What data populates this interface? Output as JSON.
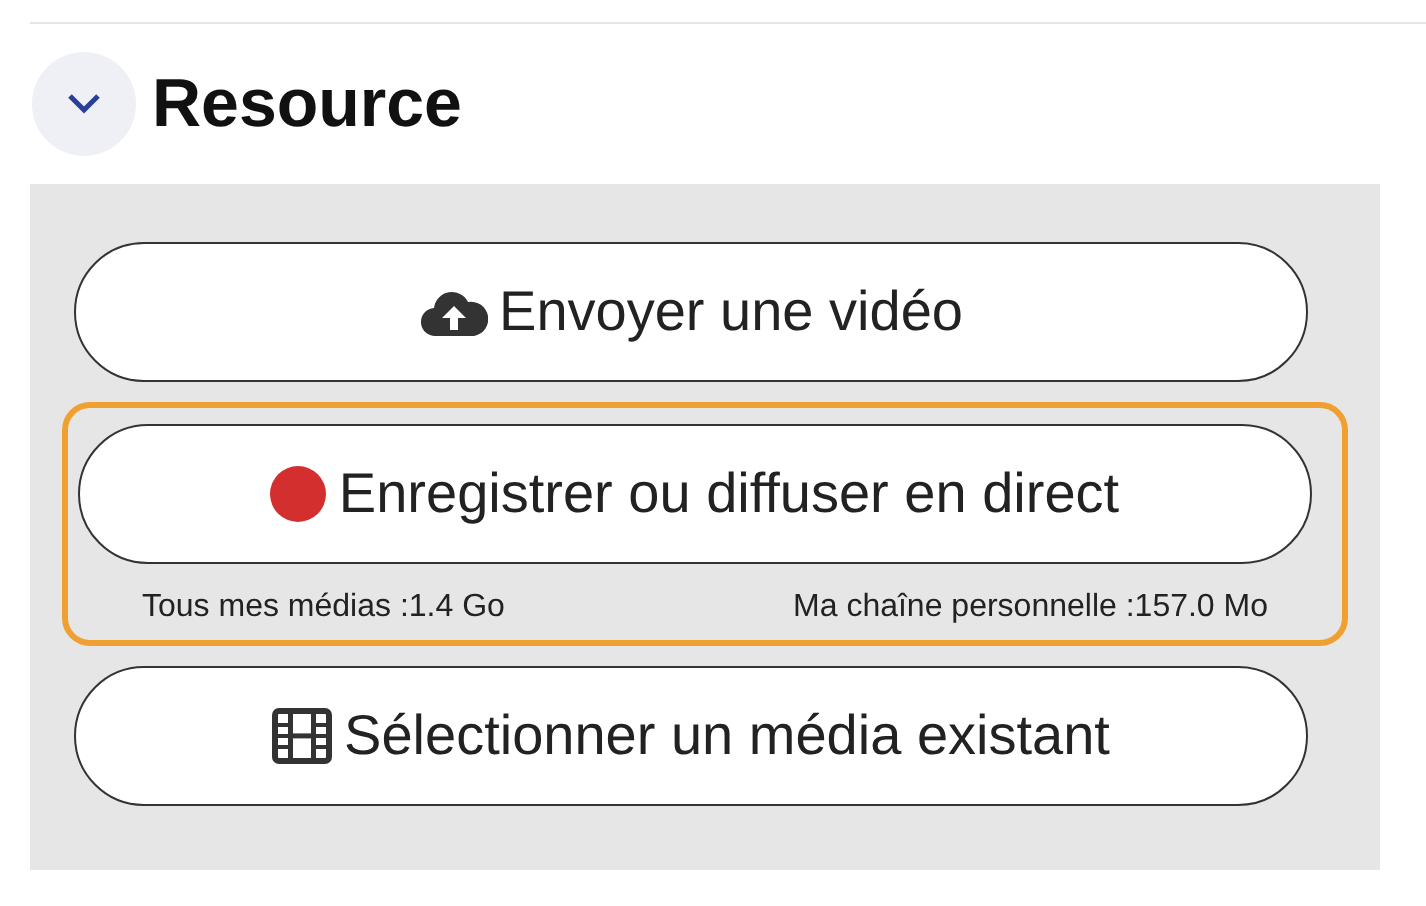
{
  "section": {
    "title": "Resource",
    "expanded": true
  },
  "actions": [
    {
      "kind": "upload",
      "label": "Envoyer une vidéo",
      "highlighted": false
    },
    {
      "kind": "record",
      "label": "Enregistrer ou diffuser en direct",
      "highlighted": true,
      "stats": [
        "Tous mes médias :1.4 Go",
        "Ma chaîne personnelle :157.0 Mo"
      ]
    },
    {
      "kind": "select",
      "label": "Sélectionner un média existant",
      "highlighted": false
    }
  ]
}
